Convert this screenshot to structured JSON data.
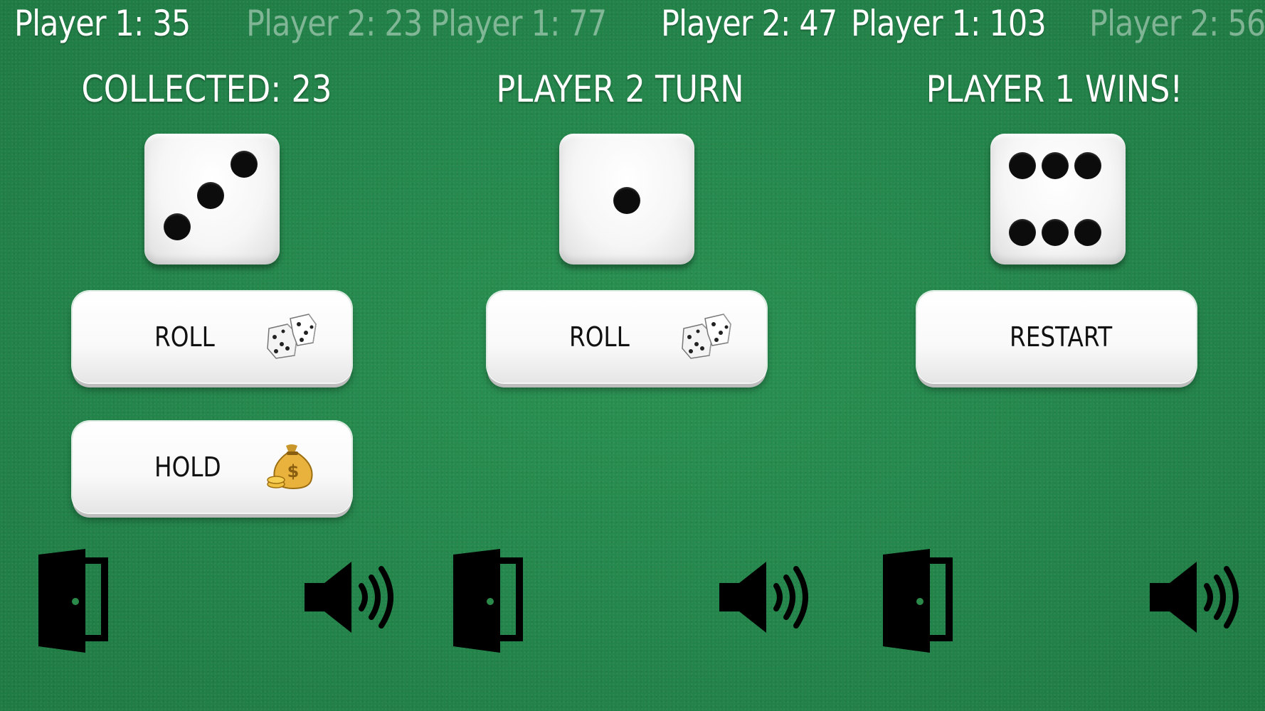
{
  "panels": [
    {
      "scores": [
        {
          "label": "Player 1: 35",
          "active": true
        },
        {
          "label": "Player 2: 23",
          "active": false
        }
      ],
      "status": "COLLECTED: 23",
      "die_value": 3,
      "buttons": [
        {
          "label": "ROLL",
          "icon": "dice-icon"
        },
        {
          "label": "HOLD",
          "icon": "money-bag-icon"
        }
      ],
      "footer_icons": [
        "exit-door-icon",
        "speaker-icon"
      ]
    },
    {
      "scores": [
        {
          "label": "Player 1: 77",
          "active": false
        },
        {
          "label": "Player 2: 47",
          "active": true
        }
      ],
      "status": "PLAYER 2 TURN",
      "die_value": 1,
      "buttons": [
        {
          "label": "ROLL",
          "icon": "dice-icon"
        }
      ],
      "footer_icons": [
        "exit-door-icon",
        "speaker-icon"
      ]
    },
    {
      "scores": [
        {
          "label": "Player 1: 103",
          "active": true
        },
        {
          "label": "Player 2: 56",
          "active": false
        }
      ],
      "status": "PLAYER 1 WINS!",
      "die_value": 6,
      "buttons": [
        {
          "label": "RESTART"
        }
      ],
      "footer_icons": [
        "exit-door-icon",
        "speaker-icon"
      ]
    }
  ],
  "colors": {
    "felt": "#24874a",
    "text": "#ffffff",
    "inactive_score": "rgba(255,255,255,0.42)",
    "button_text": "#111111",
    "pip": "#0c0c0c"
  }
}
